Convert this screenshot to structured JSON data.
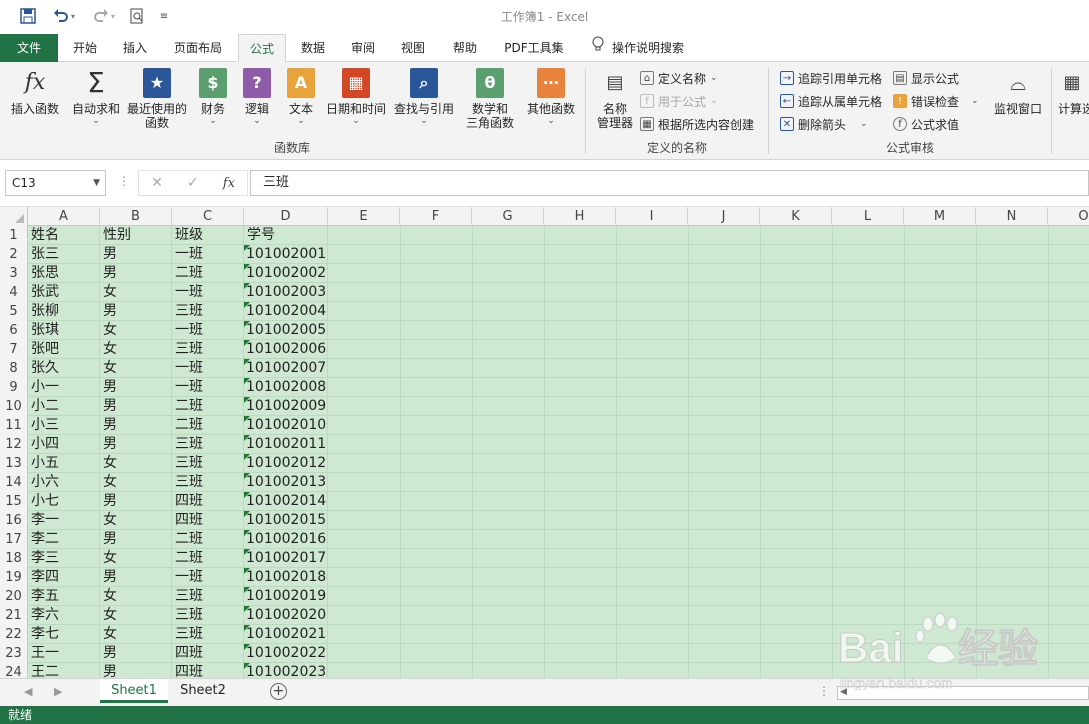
{
  "window": {
    "title": "工作簿1  -  Excel"
  },
  "quick_access": {
    "save_icon": "save-icon",
    "undo_icon": "undo-icon",
    "redo_icon": "redo-icon",
    "preview_icon": "print-preview-icon",
    "customize_icon": "customize-qat-icon"
  },
  "tabs": [
    {
      "label": "文件"
    },
    {
      "label": "开始"
    },
    {
      "label": "插入"
    },
    {
      "label": "页面布局"
    },
    {
      "label": "公式"
    },
    {
      "label": "数据"
    },
    {
      "label": "审阅"
    },
    {
      "label": "视图"
    },
    {
      "label": "帮助"
    },
    {
      "label": "PDF工具集"
    }
  ],
  "tell_me": "操作说明搜索",
  "ribbon": {
    "library": {
      "insert_function": "插入函数",
      "autosum": "自动求和",
      "recent_1": "最近使用的",
      "recent_2": "函数",
      "financial": "财务",
      "logical": "逻辑",
      "text": "文本",
      "datetime": "日期和时间",
      "lookup": "查找与引用",
      "math_1": "数学和",
      "math_2": "三角函数",
      "other": "其他函数",
      "group_label": "函数库"
    },
    "names": {
      "manager_1": "名称",
      "manager_2": "管理器",
      "define_name": "定义名称",
      "use_in_formula": "用于公式",
      "create_from_selection": "根据所选内容创建",
      "group_label": "定义的名称"
    },
    "audit": {
      "trace_precedents": "追踪引用单元格",
      "trace_dependents": "追踪从属单元格",
      "remove_arrows": "删除箭头",
      "show_formulas": "显示公式",
      "error_checking": "错误检查",
      "evaluate_formula": "公式求值",
      "group_label": "公式审核"
    },
    "watch_window": "监视窗口",
    "calculate": "计算选"
  },
  "formula_bar": {
    "name_box": "C13",
    "content": "三班"
  },
  "grid": {
    "columns": [
      "A",
      "B",
      "C",
      "D",
      "E",
      "F",
      "G",
      "H",
      "I",
      "J",
      "K",
      "L",
      "M",
      "N",
      "O"
    ],
    "row_numbers": [
      "1",
      "2",
      "3",
      "4",
      "5",
      "6",
      "7",
      "8",
      "9",
      "10",
      "11",
      "12",
      "13",
      "14",
      "15",
      "16",
      "17",
      "18",
      "19",
      "20",
      "21",
      "22",
      "23",
      "24"
    ],
    "rows": [
      [
        "姓名",
        "性别",
        "班级",
        "学号"
      ],
      [
        "张三",
        "男",
        "一班",
        "101002001"
      ],
      [
        "张思",
        "男",
        "二班",
        "101002002"
      ],
      [
        "张武",
        "女",
        "一班",
        "101002003"
      ],
      [
        "张柳",
        "男",
        "三班",
        "101002004"
      ],
      [
        "张琪",
        "女",
        "一班",
        "101002005"
      ],
      [
        "张吧",
        "女",
        "三班",
        "101002006"
      ],
      [
        "张久",
        "女",
        "一班",
        "101002007"
      ],
      [
        "小一",
        "男",
        "一班",
        "101002008"
      ],
      [
        "小二",
        "男",
        "二班",
        "101002009"
      ],
      [
        "小三",
        "男",
        "二班",
        "101002010"
      ],
      [
        "小四",
        "男",
        "三班",
        "101002011"
      ],
      [
        "小五",
        "女",
        "三班",
        "101002012"
      ],
      [
        "小六",
        "女",
        "三班",
        "101002013"
      ],
      [
        "小七",
        "男",
        "四班",
        "101002014"
      ],
      [
        "李一",
        "女",
        "四班",
        "101002015"
      ],
      [
        "李二",
        "男",
        "二班",
        "101002016"
      ],
      [
        "李三",
        "女",
        "二班",
        "101002017"
      ],
      [
        "李四",
        "男",
        "一班",
        "101002018"
      ],
      [
        "李五",
        "女",
        "三班",
        "101002019"
      ],
      [
        "李六",
        "女",
        "三班",
        "101002020"
      ],
      [
        "李七",
        "女",
        "三班",
        "101002021"
      ],
      [
        "王一",
        "男",
        "四班",
        "101002022"
      ],
      [
        "王二",
        "男",
        "四班",
        "101002023"
      ]
    ],
    "fill_color": "#cfe8d2"
  },
  "sheets": [
    {
      "label": "Sheet1",
      "active": true
    },
    {
      "label": "Sheet2",
      "active": false
    }
  ],
  "status": {
    "ready": "就绪"
  },
  "watermark": {
    "brand": "Baidu经验",
    "url": "jingyan.baidu.com"
  },
  "colors": {
    "excel_green": "#217346",
    "sheet_fill": "#cfe8d2"
  }
}
